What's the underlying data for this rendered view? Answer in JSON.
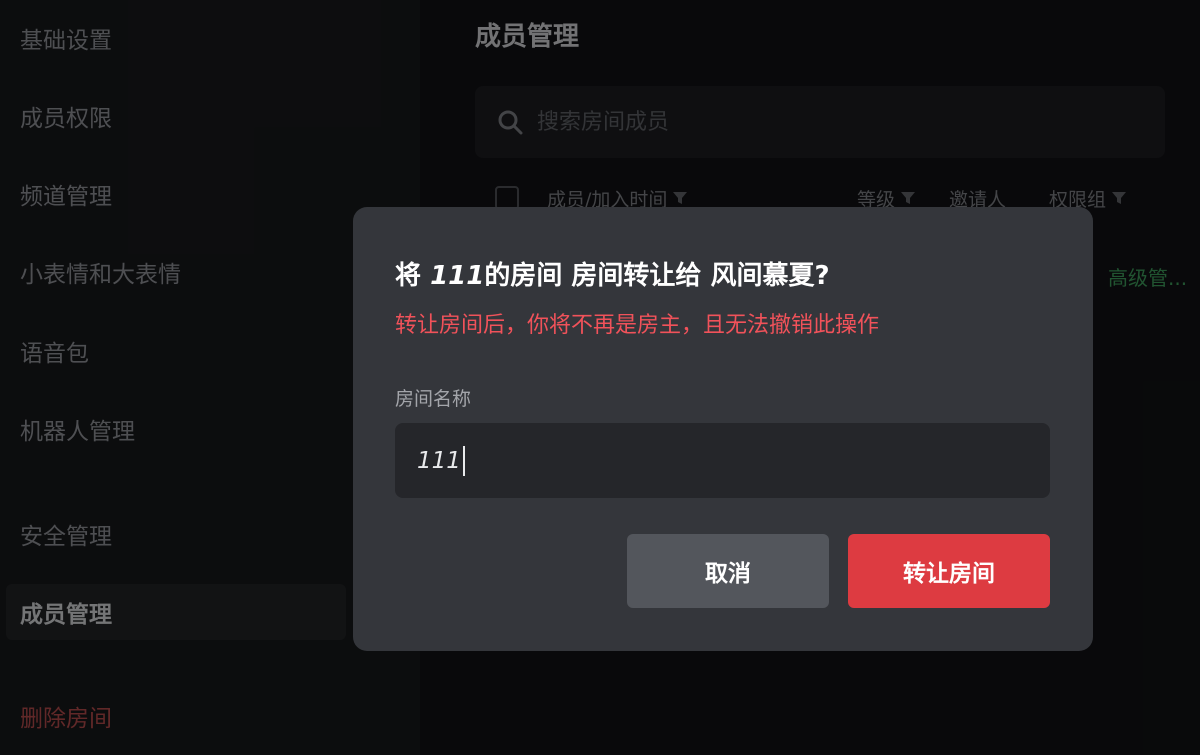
{
  "sidebar": {
    "items": [
      {
        "label": "基础设置"
      },
      {
        "label": "成员权限"
      },
      {
        "label": "频道管理"
      },
      {
        "label": "小表情和大表情"
      },
      {
        "label": "语音包"
      },
      {
        "label": "机器人管理"
      },
      {
        "label": "安全管理"
      },
      {
        "label": "成员管理",
        "active": true
      }
    ],
    "delete_label": "删除房间"
  },
  "main": {
    "title": "成员管理",
    "search_placeholder": "搜索房间成员",
    "columns": [
      "成员/加入时间",
      "等级",
      "邀请人",
      "权限组"
    ],
    "row_role": "高级管..."
  },
  "dialog": {
    "title_prefix": "将 ",
    "title_room": "111",
    "title_suffix": "的房间 房间转让给 风间慕夏?",
    "warning": "转让房间后，你将不再是房主，且无法撤销此操作",
    "field_label": "房间名称",
    "input_value": "111",
    "cancel_label": "取消",
    "confirm_label": "转让房间"
  },
  "colors": {
    "danger": "#dd3b41",
    "warning_text": "#f1525a",
    "role_green": "#3d9a5a"
  }
}
